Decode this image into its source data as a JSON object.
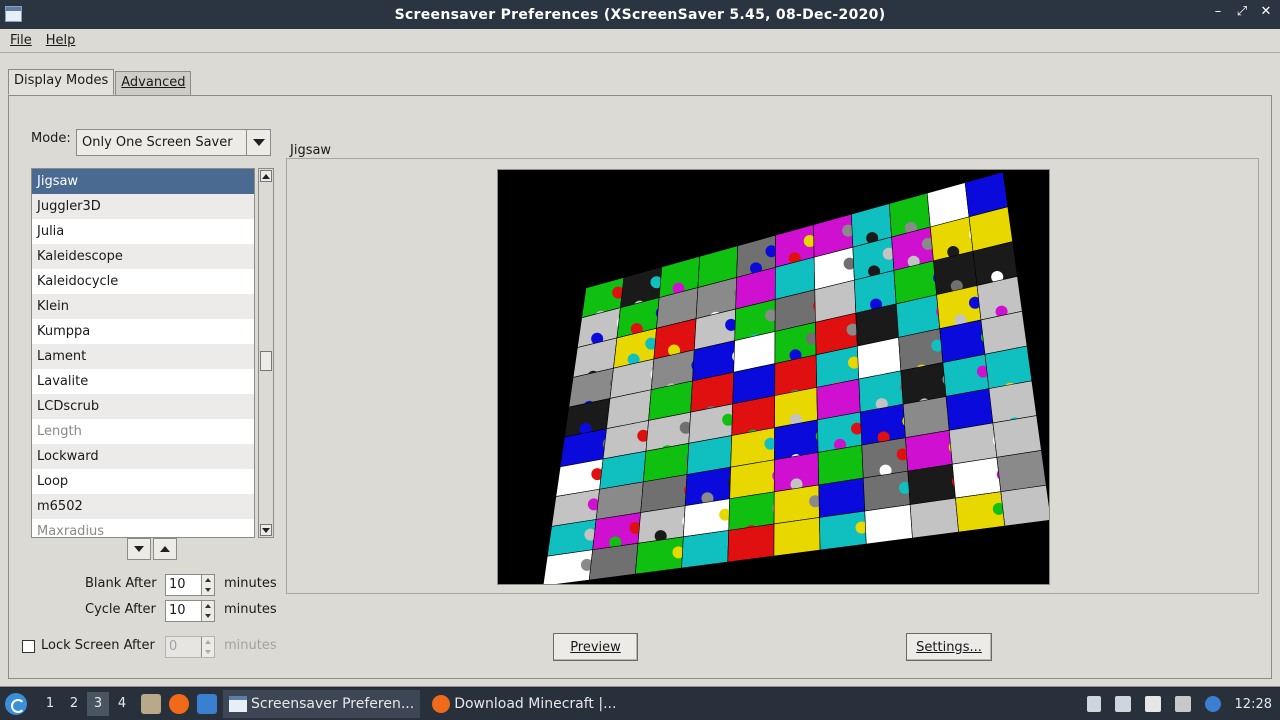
{
  "window": {
    "title": "Screensaver Preferences  (XScreenSaver 5.45, 08-Dec-2020)",
    "controls": [
      "–",
      "⤢",
      "✕"
    ]
  },
  "menubar": {
    "file": "File",
    "help": "Help"
  },
  "tabs": {
    "display_modes": "Display Modes",
    "advanced": "Advanced"
  },
  "mode": {
    "label": "Mode:",
    "value": "Only One Screen Saver"
  },
  "hacks": {
    "items": [
      {
        "name": "Jigsaw",
        "state": "selected"
      },
      {
        "name": "Juggler3D",
        "state": "normal"
      },
      {
        "name": "Julia",
        "state": "normal"
      },
      {
        "name": "Kaleidescope",
        "state": "normal"
      },
      {
        "name": "Kaleidocycle",
        "state": "normal"
      },
      {
        "name": "Klein",
        "state": "normal"
      },
      {
        "name": "Kumppa",
        "state": "normal"
      },
      {
        "name": "Lament",
        "state": "normal"
      },
      {
        "name": "Lavalite",
        "state": "normal"
      },
      {
        "name": "LCDscrub",
        "state": "normal"
      },
      {
        "name": "Length",
        "state": "disabled"
      },
      {
        "name": "Lockward",
        "state": "normal"
      },
      {
        "name": "Loop",
        "state": "normal"
      },
      {
        "name": "m6502",
        "state": "normal"
      },
      {
        "name": "Maxradius",
        "state": "disabled"
      }
    ]
  },
  "timing": {
    "blank_after_label": "Blank After",
    "blank_after_value": "10",
    "cycle_after_label": "Cycle After",
    "cycle_after_value": "10",
    "lock_label": "Lock Screen After",
    "lock_value": "0",
    "lock_checked": false,
    "unit": "minutes"
  },
  "preview": {
    "frame_title": "Jigsaw",
    "preview_button": "Preview",
    "settings_button": "Settings..."
  },
  "puzzle_colors": [
    "#c3c3c3",
    "#e8d800",
    "#e01010",
    "#10c0c0",
    "#0a0adc",
    "#10c010",
    "#d010d0",
    "#ffffff",
    "#8a8a8a",
    "#1a1a1a",
    "#707070"
  ],
  "taskbar": {
    "workspaces": [
      "1",
      "2",
      "3",
      "4"
    ],
    "active_workspace": "3",
    "tasks": [
      {
        "label": "Screensaver Preferen...",
        "active": true
      },
      {
        "label": "Download Minecraft |...",
        "active": false
      }
    ],
    "clock": "12:28"
  }
}
